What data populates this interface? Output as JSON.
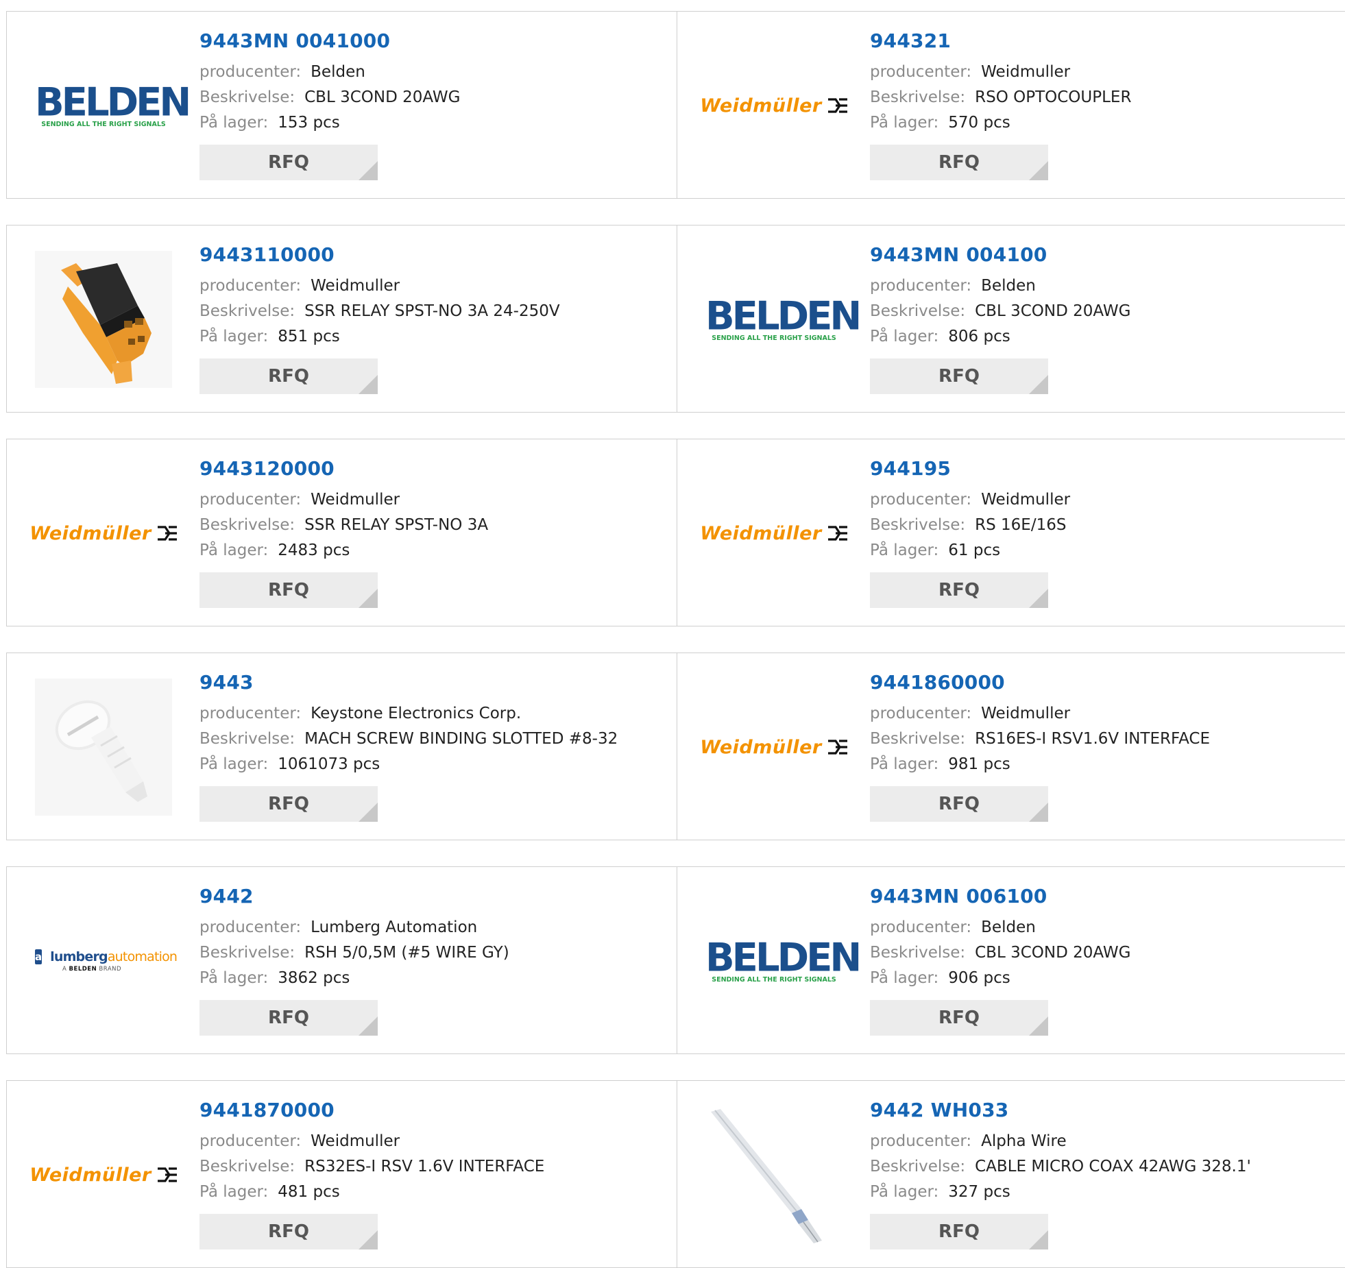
{
  "labels": {
    "manufacturer": "producenter:",
    "description": "Beskrivelse:",
    "stock": "På lager:",
    "rfq": "RFQ"
  },
  "logos": {
    "belden": {
      "word": "BELDEN",
      "tagline": "SENDING ALL THE RIGHT SIGNALS",
      "color": "#1b4f8c",
      "tagline_color": "#2aa14a"
    },
    "weidmuller": {
      "word": "Weidmüller",
      "color": "#f39200"
    },
    "lumberg": {
      "box": "a",
      "word_a": "lumberg",
      "word_b": "automation",
      "sub_a": "A ",
      "sub_b": "BELDEN",
      "sub_c": " BRAND"
    }
  },
  "colors": {
    "link": "#1565b4",
    "button_bg": "#ececec",
    "button_text": "#555555",
    "border": "#cfcfcf"
  },
  "products": [
    {
      "part_number": "9443MN 0041000",
      "manufacturer": "Belden",
      "description": "CBL 3COND 20AWG",
      "stock": "153 pcs",
      "image": "belden-logo"
    },
    {
      "part_number": "944321",
      "manufacturer": "Weidmuller",
      "description": "RSO OPTOCOUPLER",
      "stock": "570 pcs",
      "image": "weidmuller-logo"
    },
    {
      "part_number": "9443110000",
      "manufacturer": "Weidmuller",
      "description": "SSR RELAY SPST-NO 3A 24-250V",
      "stock": "851 pcs",
      "image": "relay-photo"
    },
    {
      "part_number": "9443MN 004100",
      "manufacturer": "Belden",
      "description": "CBL 3COND 20AWG",
      "stock": "806 pcs",
      "image": "belden-logo"
    },
    {
      "part_number": "9443120000",
      "manufacturer": "Weidmuller",
      "description": "SSR RELAY SPST-NO 3A",
      "stock": "2483 pcs",
      "image": "weidmuller-logo"
    },
    {
      "part_number": "944195",
      "manufacturer": "Weidmuller",
      "description": "RS 16E/16S",
      "stock": "61 pcs",
      "image": "weidmuller-logo"
    },
    {
      "part_number": "9443",
      "manufacturer": "Keystone Electronics Corp.",
      "description": "MACH SCREW BINDING SLOTTED #8-32",
      "stock": "1061073 pcs",
      "image": "screw-photo"
    },
    {
      "part_number": "9441860000",
      "manufacturer": "Weidmuller",
      "description": "RS16ES-I RSV1.6V INTERFACE",
      "stock": "981 pcs",
      "image": "weidmuller-logo"
    },
    {
      "part_number": "9442",
      "manufacturer": "Lumberg Automation",
      "description": "RSH 5/0,5M (#5 WIRE GY)",
      "stock": "3862 pcs",
      "image": "lumberg-logo"
    },
    {
      "part_number": "9443MN 006100",
      "manufacturer": "Belden",
      "description": "CBL 3COND 20AWG",
      "stock": "906 pcs",
      "image": "belden-logo"
    },
    {
      "part_number": "9441870000",
      "manufacturer": "Weidmuller",
      "description": "RS32ES-I RSV 1.6V INTERFACE",
      "stock": "481 pcs",
      "image": "weidmuller-logo"
    },
    {
      "part_number": "9442 WH033",
      "manufacturer": "Alpha Wire",
      "description": "CABLE MICRO COAX 42AWG 328.1'",
      "stock": "327 pcs",
      "image": "coax-cable-photo"
    }
  ]
}
